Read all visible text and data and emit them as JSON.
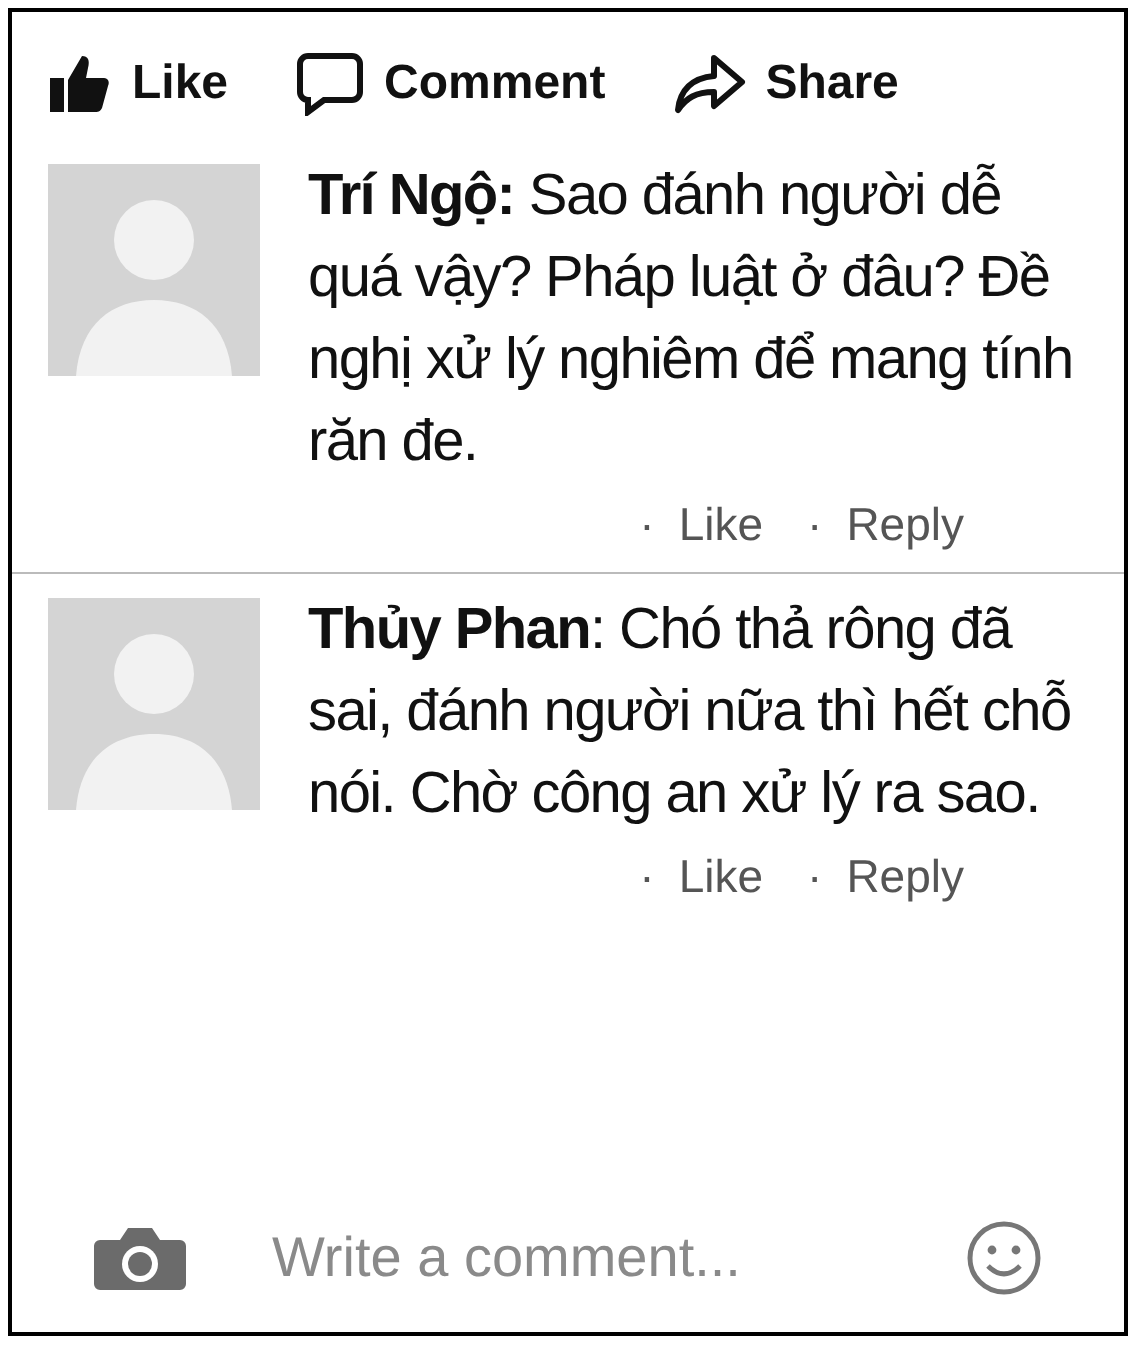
{
  "actions": [
    {
      "kind": "like",
      "label": "Like"
    },
    {
      "kind": "comment",
      "label": "Comment"
    },
    {
      "kind": "share",
      "label": "Share"
    }
  ],
  "comments": [
    {
      "author": "Trí Ngộ:",
      "text": "Sao đánh người dễ quá vậy? Pháp luật ở đâu? Đề nghị xử lý nghiêm để mang tính răn đe.",
      "like": "Like",
      "reply": "Reply",
      "separator": "·"
    },
    {
      "author": "Thủy Phan",
      "text": ": Chó thả rông đã sai, đánh người nữa thì hết chỗ nói. Chờ công an xử lý ra sao.",
      "like": "Like",
      "reply": "Reply",
      "separator": "·"
    }
  ],
  "composer": {
    "placeholder": "Write a comment..."
  }
}
